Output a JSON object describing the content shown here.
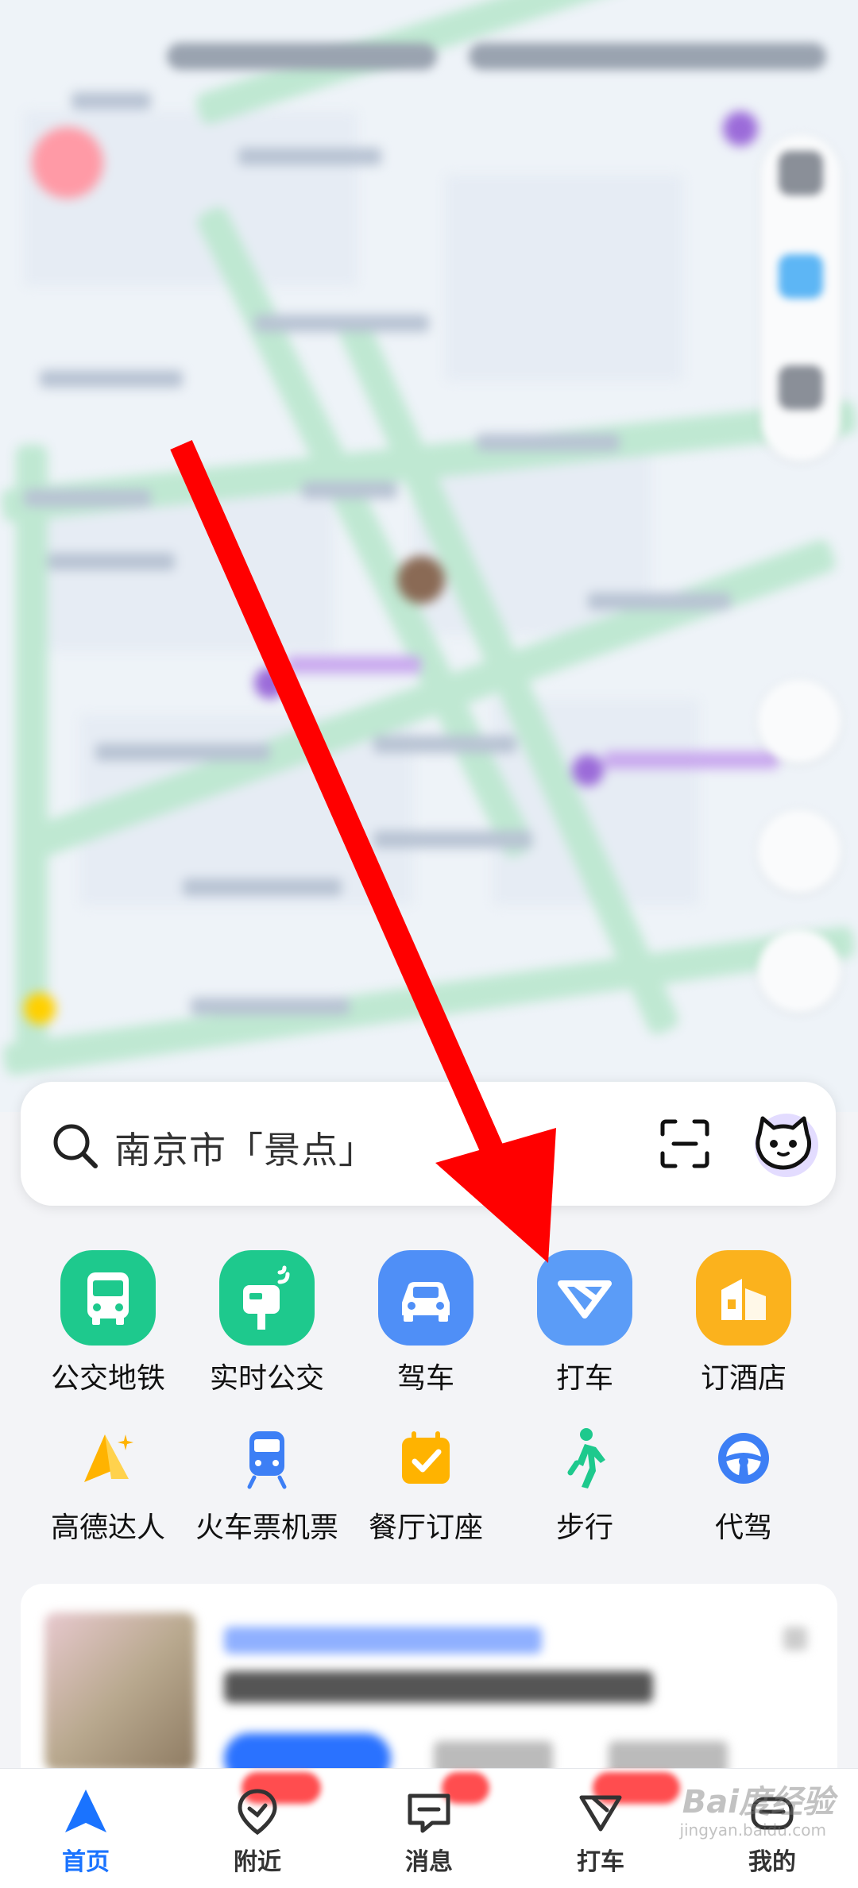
{
  "search": {
    "placeholder_text": "南京市「景点」"
  },
  "quick_actions": [
    {
      "label": "公交地铁",
      "icon": "bus-icon",
      "color": "#1ec98d"
    },
    {
      "label": "实时公交",
      "icon": "realtime-bus-icon",
      "color": "#1ec98d"
    },
    {
      "label": "驾车",
      "icon": "car-icon",
      "color": "#4f8ff7"
    },
    {
      "label": "打车",
      "icon": "taxi-icon",
      "color": "#5b9cf7"
    },
    {
      "label": "订酒店",
      "icon": "hotel-icon",
      "color": "#fbb21d"
    }
  ],
  "services": [
    {
      "label": "高德达人",
      "icon": "expert-icon",
      "color": "#ffb300"
    },
    {
      "label": "火车票机票",
      "icon": "train-icon",
      "color": "#3d7ff5"
    },
    {
      "label": "餐厅订座",
      "icon": "restaurant-icon",
      "color": "#ffb300"
    },
    {
      "label": "步行",
      "icon": "walk-icon",
      "color": "#1ec98d"
    },
    {
      "label": "代驾",
      "icon": "steering-wheel-icon",
      "color": "#3d7ff5"
    }
  ],
  "tabs": [
    {
      "label": "首页",
      "icon": "home-icon",
      "active": true
    },
    {
      "label": "附近",
      "icon": "location-pin-icon",
      "active": false
    },
    {
      "label": "消息",
      "icon": "message-icon",
      "active": false
    },
    {
      "label": "打车",
      "icon": "taxi-tab-icon",
      "active": false
    },
    {
      "label": "我的",
      "icon": "profile-icon",
      "active": false
    }
  ],
  "watermark": {
    "text": "Bai度经验",
    "sub": "jingyan.baidu.com"
  },
  "colors": {
    "accent": "#1a73ff",
    "annotation_arrow": "#ff0000"
  }
}
